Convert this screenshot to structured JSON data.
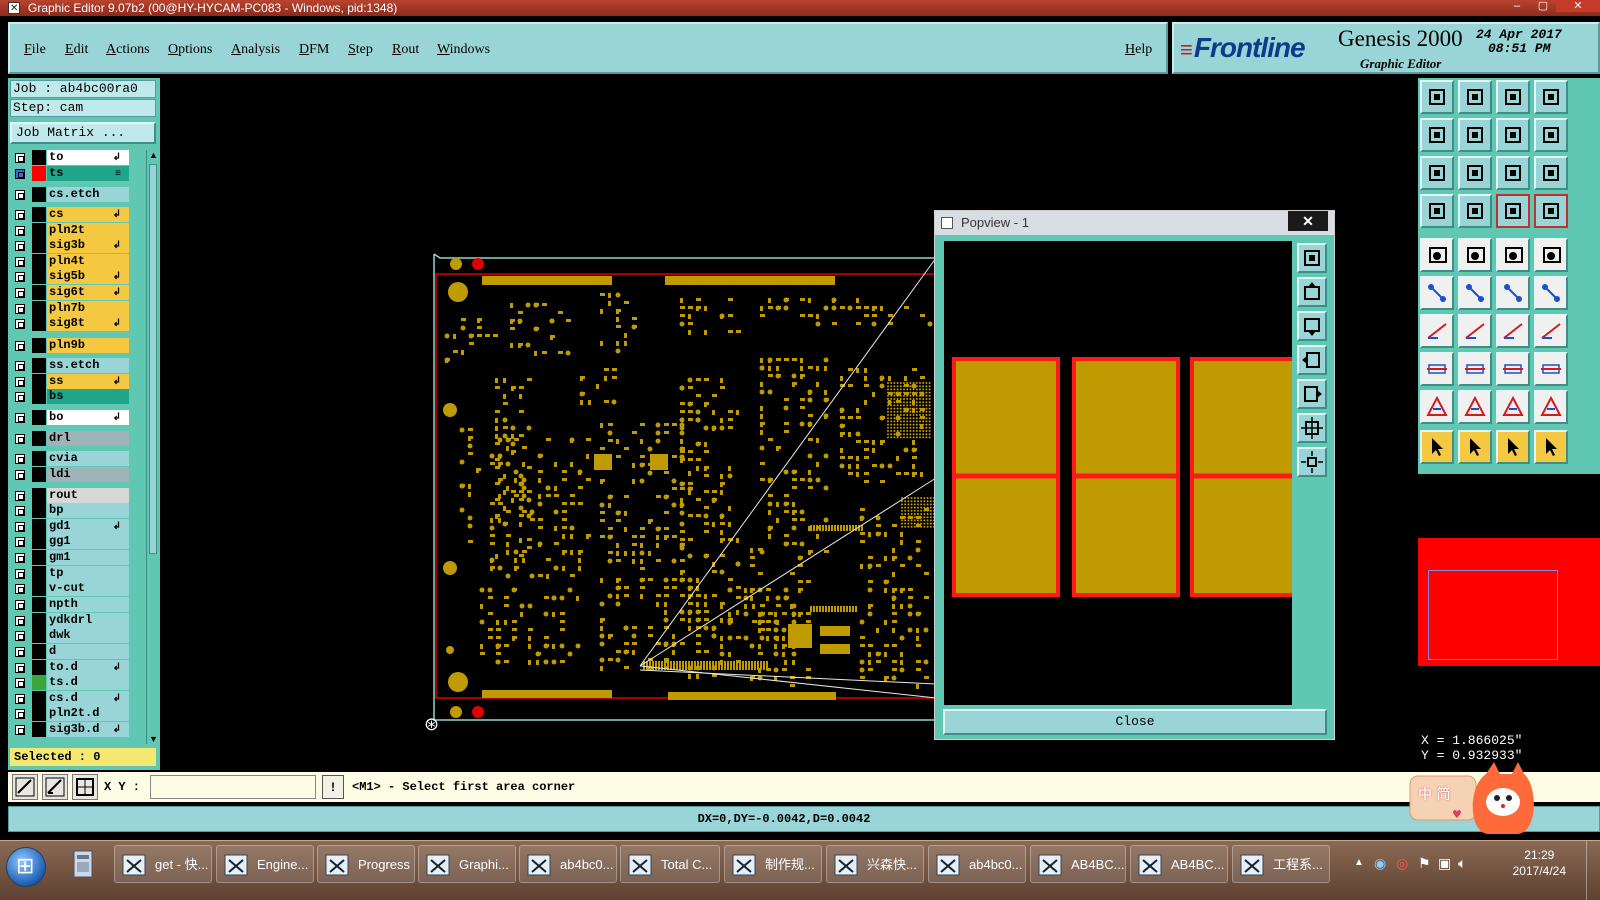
{
  "window": {
    "title": "Graphic Editor 9.07b2 (00@HY-HYCAM-PC083 - Windows, pid:1348)"
  },
  "menu": {
    "file": "File",
    "edit": "Edit",
    "actions": "Actions",
    "options": "Options",
    "analysis": "Analysis",
    "dfm": "DFM",
    "step": "Step",
    "rout": "Rout",
    "windows": "Windows",
    "help": "Help"
  },
  "logo": {
    "brand": "Frontline",
    "product": "Genesis 2000",
    "subtitle": "Graphic Editor",
    "date": "24 Apr 2017",
    "time": "08:51 PM"
  },
  "job": {
    "job_line": "Job : ab4bc00ra0",
    "step_line": "Step: cam",
    "matrix_button": "Job Matrix ...",
    "selected": "Selected : 0"
  },
  "layers": [
    {
      "name": "to",
      "color": "#ffffff",
      "swatch": "#000000",
      "mark": "↲"
    },
    {
      "name": "ts",
      "color": "#1fa68a",
      "swatch": "#ff0000",
      "mark": "≡",
      "active": true
    },
    {
      "name": "cs.etch",
      "color": "#99d5d7",
      "swatch": "#000000",
      "mark": ""
    },
    {
      "name": "cs",
      "color": "#f5c842",
      "swatch": "#000000",
      "mark": "↲"
    },
    {
      "name": "pln2t",
      "color": "#f5c842",
      "swatch": "#000000",
      "mark": ""
    },
    {
      "name": "sig3b",
      "color": "#f5c842",
      "swatch": "#000000",
      "mark": "↲"
    },
    {
      "name": "pln4t",
      "color": "#f5c842",
      "swatch": "#000000",
      "mark": ""
    },
    {
      "name": "sig5b",
      "color": "#f5c842",
      "swatch": "#000000",
      "mark": "↲"
    },
    {
      "name": "sig6t",
      "color": "#f5c842",
      "swatch": "#000000",
      "mark": "↲"
    },
    {
      "name": "pln7b",
      "color": "#f5c842",
      "swatch": "#000000",
      "mark": ""
    },
    {
      "name": "sig8t",
      "color": "#f5c842",
      "swatch": "#000000",
      "mark": "↲"
    },
    {
      "name": "pln9b",
      "color": "#f5c842",
      "swatch": "#000000",
      "mark": ""
    },
    {
      "name": "ss.etch",
      "color": "#99d5d7",
      "swatch": "#000000",
      "mark": ""
    },
    {
      "name": "ss",
      "color": "#f5c842",
      "swatch": "#000000",
      "mark": "↲"
    },
    {
      "name": "bs",
      "color": "#1fa68a",
      "swatch": "#000000",
      "mark": ""
    },
    {
      "name": "bo",
      "color": "#ffffff",
      "swatch": "#000000",
      "mark": "↲"
    },
    {
      "name": "drl",
      "color": "#9fb4b8",
      "swatch": "#000000",
      "mark": ""
    },
    {
      "name": "cvia",
      "color": "#99d5d7",
      "swatch": "#000000",
      "mark": ""
    },
    {
      "name": "ldi",
      "color": "#9fb4b8",
      "swatch": "#000000",
      "mark": ""
    },
    {
      "name": "rout",
      "color": "#d8d8d8",
      "swatch": "#000000",
      "mark": ""
    },
    {
      "name": "bp",
      "color": "#99d5d7",
      "swatch": "#000000",
      "mark": ""
    },
    {
      "name": "gd1",
      "color": "#99d5d7",
      "swatch": "#000000",
      "mark": "↲"
    },
    {
      "name": "gg1",
      "color": "#99d5d7",
      "swatch": "#000000",
      "mark": ""
    },
    {
      "name": "gm1",
      "color": "#99d5d7",
      "swatch": "#000000",
      "mark": ""
    },
    {
      "name": "tp",
      "color": "#99d5d7",
      "swatch": "#000000",
      "mark": ""
    },
    {
      "name": "v-cut",
      "color": "#99d5d7",
      "swatch": "#000000",
      "mark": ""
    },
    {
      "name": "npth",
      "color": "#99d5d7",
      "swatch": "#000000",
      "mark": ""
    },
    {
      "name": "ydkdrl",
      "color": "#99d5d7",
      "swatch": "#000000",
      "mark": ""
    },
    {
      "name": "dwk",
      "color": "#99d5d7",
      "swatch": "#000000",
      "mark": ""
    },
    {
      "name": "d",
      "color": "#99d5d7",
      "swatch": "#000000",
      "mark": ""
    },
    {
      "name": "to.d",
      "color": "#99d5d7",
      "swatch": "#000000",
      "mark": "↲"
    },
    {
      "name": "ts.d",
      "color": "#99d5d7",
      "swatch": "#3aa63a",
      "mark": ""
    },
    {
      "name": "cs.d",
      "color": "#99d5d7",
      "swatch": "#000000",
      "mark": "↲"
    },
    {
      "name": "pln2t.d",
      "color": "#99d5d7",
      "swatch": "#000000",
      "mark": ""
    },
    {
      "name": "sig3b.d",
      "color": "#99d5d7",
      "swatch": "#000000",
      "mark": "↲"
    }
  ],
  "popview": {
    "title": "Popview - 1",
    "close_label": "Close",
    "close_x": "✕"
  },
  "command": {
    "xy_label": "X Y :",
    "xy_value": "",
    "excl": "!",
    "prompt": "<M1> - Select first area corner",
    "status": "DX=0,DY=-0.0042,D=0.0042"
  },
  "coords": {
    "x": "X = 1.866025\"",
    "y": "Y = 0.932933\""
  },
  "ime": {
    "text": "中 简"
  },
  "taskbar": {
    "items": [
      "get - 快...",
      "Engine...",
      "Progress",
      "Graphi...",
      "ab4bc0...",
      "Total C...",
      "制作规...",
      "兴森快...",
      "ab4bc0...",
      "AB4BC...",
      "AB4BC...",
      "工程系..."
    ],
    "time": "21:29",
    "date": "2017/4/24"
  },
  "colors": {
    "panel": "#99d5d7",
    "panel_dark": "#5fc7b2",
    "pad": "#bf9a00",
    "outline": "#e00000"
  }
}
